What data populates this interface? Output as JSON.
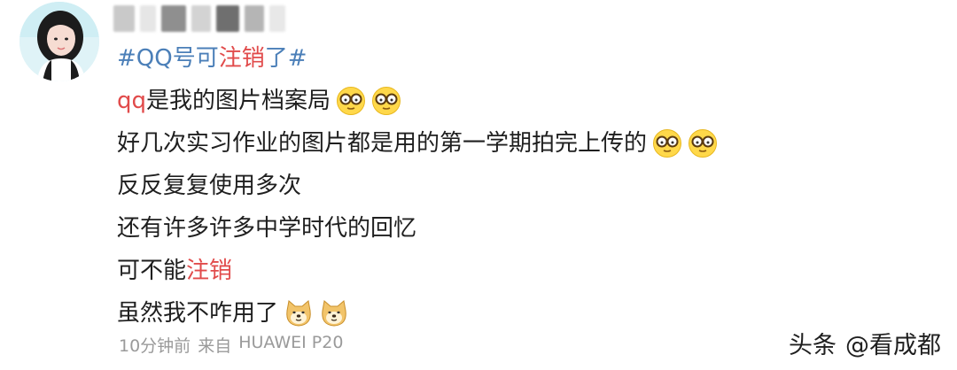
{
  "post": {
    "topic": {
      "hash_open": "#",
      "blue_text": "QQ号可",
      "red_text": "注销",
      "blue_text2": "了",
      "hash_close": "#"
    },
    "lines": {
      "l1_red": "qq",
      "l1_text": "是我的图片档案局",
      "l2_text": "好几次实习作业的图片都是用的第一学期拍完上传的",
      "l3_text": "反反复复使用多次",
      "l4_text": "还有许多许多中学时代的回忆",
      "l5_text": "可不能",
      "l5_red": "注销",
      "l6_text": "虽然我不咋用了"
    },
    "emoji": {
      "glasses": "glasses-face-emoji",
      "doge": "doge-emoji"
    }
  },
  "footer": {
    "time": "10分钟前",
    "from_label": "来自",
    "device": "HUAWEI P20"
  },
  "watermark": {
    "platform": "头条",
    "account": "@看成都"
  },
  "colors": {
    "topic_blue": "#4b7fb8",
    "highlight_red": "#e14b4b",
    "meta_gray": "#9a9a9a"
  }
}
